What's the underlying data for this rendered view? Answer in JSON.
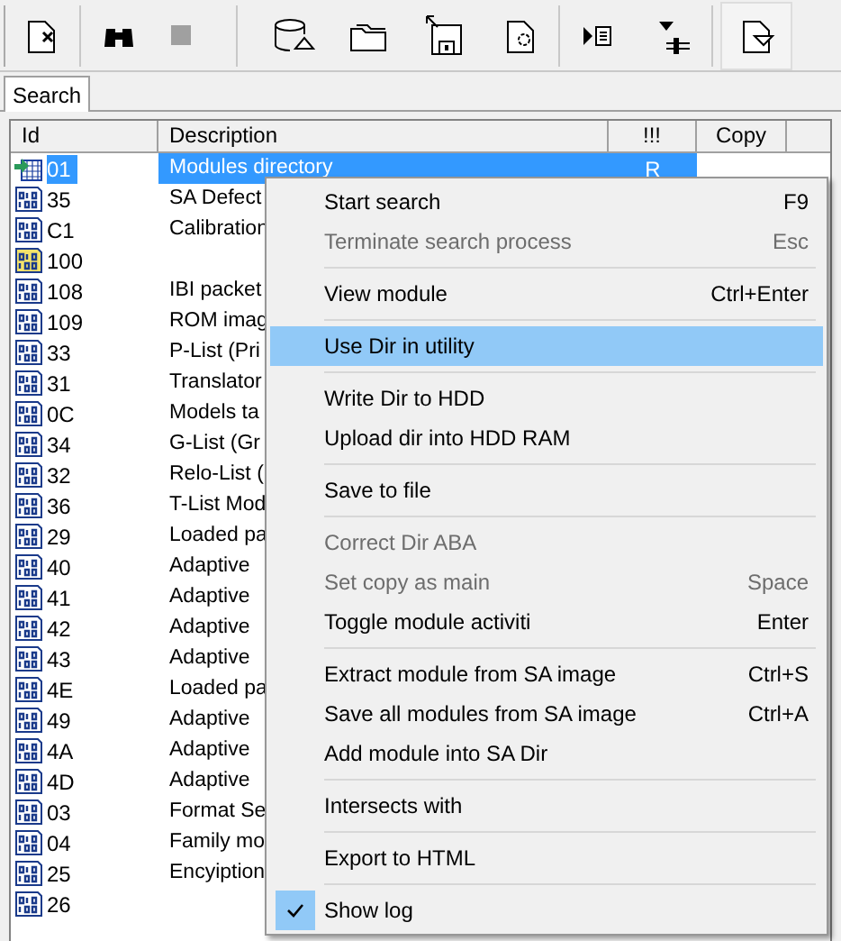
{
  "tabs": [
    {
      "label": "Search",
      "selected": true
    }
  ],
  "table": {
    "columns": [
      "Id",
      "Description",
      "!!!",
      "Copy"
    ],
    "rows": [
      {
        "kind": "dir",
        "id": "01",
        "description": "Modules directory",
        "flag": "R",
        "selected": true
      },
      {
        "kind": "module",
        "id": "35",
        "description": "SA Defect",
        "selected": false
      },
      {
        "kind": "module",
        "id": "C1",
        "description": "Calibration",
        "selected": false
      },
      {
        "kind": "module_alt",
        "id": "100",
        "selected": false
      },
      {
        "kind": "module",
        "id": "108",
        "description": "IBI packet",
        "selected": false
      },
      {
        "kind": "module",
        "id": "109",
        "description": "ROM imag",
        "selected": false
      },
      {
        "kind": "module",
        "id": "33",
        "description": "P-List (Pri",
        "selected": false
      },
      {
        "kind": "module",
        "id": "31",
        "description": "Translator",
        "selected": false
      },
      {
        "kind": "module",
        "id": "0C",
        "description": "Models ta",
        "selected": false
      },
      {
        "kind": "module",
        "id": "34",
        "description": "G-List (Gr",
        "selected": false
      },
      {
        "kind": "module",
        "id": "32",
        "description": "Relo-List (",
        "selected": false
      },
      {
        "kind": "module",
        "id": "36",
        "description": "T-List Mod",
        "selected": false
      },
      {
        "kind": "module",
        "id": "29",
        "description": "Loaded pa",
        "selected": false
      },
      {
        "kind": "module",
        "id": "40",
        "description": "Adaptive",
        "selected": false
      },
      {
        "kind": "module",
        "id": "41",
        "description": "Adaptive",
        "selected": false
      },
      {
        "kind": "module",
        "id": "42",
        "description": "Adaptive",
        "selected": false
      },
      {
        "kind": "module",
        "id": "43",
        "description": "Adaptive",
        "selected": false
      },
      {
        "kind": "module",
        "id": "4E",
        "description": "Loaded pa",
        "selected": false
      },
      {
        "kind": "module",
        "id": "49",
        "description": "Adaptive",
        "selected": false
      },
      {
        "kind": "module",
        "id": "4A",
        "description": "Adaptive",
        "selected": false
      },
      {
        "kind": "module",
        "id": "4D",
        "description": "Adaptive",
        "selected": false
      },
      {
        "kind": "module",
        "id": "03",
        "description": "Format Se",
        "selected": false
      },
      {
        "kind": "module",
        "id": "04",
        "description": "Family mo",
        "selected": false
      },
      {
        "kind": "module",
        "id": "25",
        "description": "Encyiption",
        "selected": false
      },
      {
        "kind": "module",
        "id": "26",
        "selected": false
      }
    ]
  },
  "context_menu": {
    "items": [
      {
        "kind": "item",
        "label": "Start search",
        "shortcut": "F9",
        "disabled": false,
        "selected": false,
        "checked": false
      },
      {
        "kind": "item",
        "label": "Terminate search process",
        "shortcut": "Esc",
        "disabled": true,
        "selected": false,
        "checked": false
      },
      {
        "kind": "separator"
      },
      {
        "kind": "item",
        "label": "View module",
        "shortcut": "Ctrl+Enter",
        "disabled": false,
        "selected": false,
        "checked": false
      },
      {
        "kind": "separator"
      },
      {
        "kind": "item",
        "label": "Use Dir in utility",
        "disabled": false,
        "selected": true,
        "checked": false
      },
      {
        "kind": "separator"
      },
      {
        "kind": "item",
        "label": "Write Dir to HDD",
        "disabled": false,
        "selected": false,
        "checked": false
      },
      {
        "kind": "item",
        "label": "Upload dir into HDD RAM",
        "disabled": false,
        "selected": false,
        "checked": false
      },
      {
        "kind": "separator"
      },
      {
        "kind": "item",
        "label": "Save to file",
        "disabled": false,
        "selected": false,
        "checked": false
      },
      {
        "kind": "separator"
      },
      {
        "kind": "item",
        "label": "Correct Dir ABA",
        "disabled": true,
        "selected": false,
        "checked": false
      },
      {
        "kind": "item",
        "label": "Set copy as main",
        "shortcut": "Space",
        "disabled": true,
        "selected": false,
        "checked": false
      },
      {
        "kind": "item",
        "label": "Toggle module activiti",
        "shortcut": "Enter",
        "disabled": false,
        "selected": false,
        "checked": false
      },
      {
        "kind": "separator"
      },
      {
        "kind": "item",
        "label": "Extract module from SA image",
        "shortcut": "Ctrl+S",
        "disabled": false,
        "selected": false,
        "checked": false
      },
      {
        "kind": "item",
        "label": "Save all modules from SA image",
        "shortcut": "Ctrl+A",
        "disabled": false,
        "selected": false,
        "checked": false
      },
      {
        "kind": "item",
        "label": "Add module into SA Dir",
        "disabled": false,
        "selected": false,
        "checked": false
      },
      {
        "kind": "separator"
      },
      {
        "kind": "item",
        "label": "Intersects with",
        "disabled": false,
        "selected": false,
        "checked": false
      },
      {
        "kind": "separator"
      },
      {
        "kind": "item",
        "label": "Export to HTML",
        "disabled": false,
        "selected": false,
        "checked": false
      },
      {
        "kind": "separator"
      },
      {
        "kind": "item",
        "label": "Show log",
        "disabled": false,
        "selected": false,
        "checked": true
      }
    ]
  }
}
